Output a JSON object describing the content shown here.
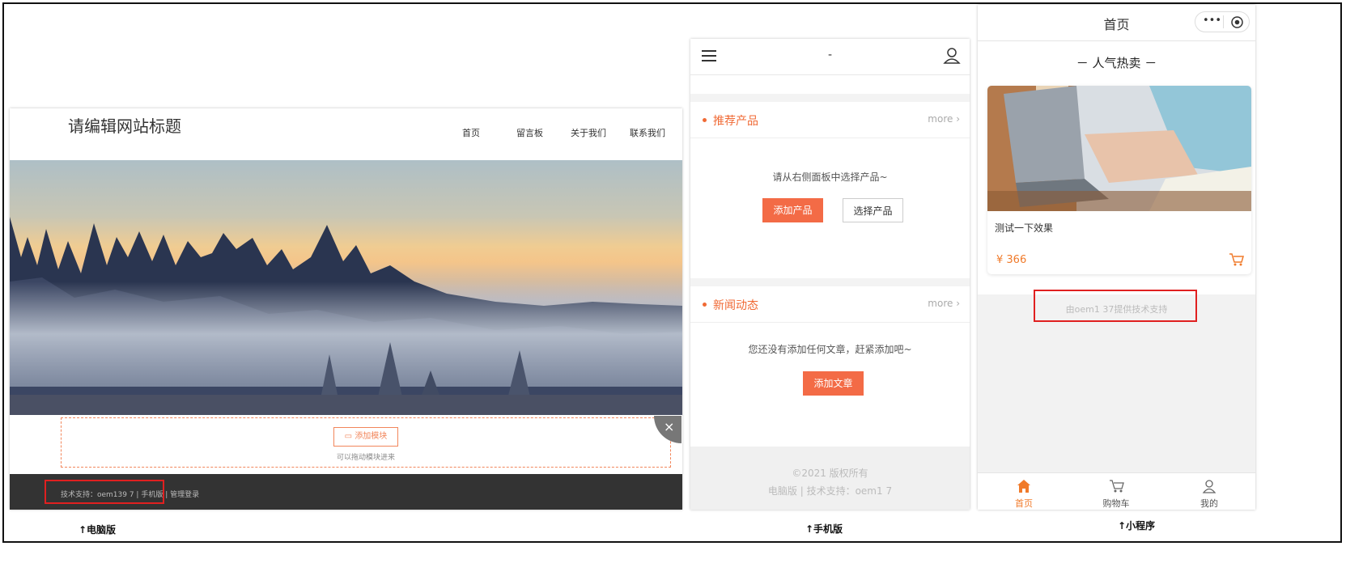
{
  "desktop": {
    "site_title": "请编辑网站标题",
    "nav": [
      "首页",
      "留言板",
      "关于我们",
      "联系我们"
    ],
    "add_module_label": "添加模块",
    "add_module_hint": "可以拖动模块进来",
    "close_icon": "×",
    "footer_text": "技术支持：oem139         7 | 手机版 | 管理登录",
    "caption": "↑电脑版"
  },
  "mobile": {
    "header_title": "-",
    "menu_icon": "hamburger-icon",
    "user_icon": "user-icon",
    "products": {
      "title": "推荐产品",
      "more": "more ›",
      "hint": "请从右侧面板中选择产品~",
      "add_button": "添加产品",
      "select_button": "选择产品"
    },
    "news": {
      "title": "新闻动态",
      "more": "more ›",
      "hint": "您还没有添加任何文章，赶紧添加吧~",
      "add_button": "添加文章"
    },
    "footer": {
      "copyright": "©2021 版权所有",
      "links": "电脑版 | 技术支持：oem1          7"
    },
    "caption": "↑手机版"
  },
  "miniprogram": {
    "page_title": "首页",
    "section_title": "－ 人气热卖 －",
    "product": {
      "name": "测试一下效果",
      "price": "¥ 366"
    },
    "support_text": "由oem1          37提供技术支持",
    "tabs": [
      "首页",
      "购物车",
      "我的"
    ],
    "caption": "↑小程序"
  },
  "colors": {
    "accent": "#f06a35",
    "highlight_box": "#e02020",
    "footer_dark": "#333333"
  }
}
